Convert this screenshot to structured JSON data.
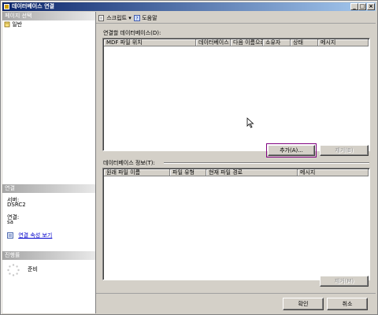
{
  "window": {
    "title": "데이터베이스 연결"
  },
  "sidebar": {
    "page_select_header": "페이지 선택",
    "pages": [
      {
        "label": "일반"
      }
    ],
    "connection_header": "연결",
    "server_label": "서버:",
    "server_value": "DSRC2",
    "connection_label": "연결:",
    "connection_value": "sa",
    "view_properties_link": "연결 속성 보기",
    "progress_header": "진행률",
    "progress_status": "준비"
  },
  "toolbar": {
    "script_label": "스크립트",
    "help_label": "도움말"
  },
  "attach_section": {
    "label": "연결할 데이터베이스(D):",
    "columns": [
      "MDF 파일 위치",
      "데이터베이스",
      "다음 이름으로...",
      "소유자",
      "상태",
      "메시지"
    ],
    "rows": [],
    "add_button": "추가(A)...",
    "remove_button": "제거(B)"
  },
  "details_section": {
    "label": "데이터베이스 정보(T):",
    "columns": [
      "원래 파일 이름",
      "파일 유형",
      "현재 파일 경로",
      "메시지"
    ],
    "rows": [],
    "remove_button": "제거(M)"
  },
  "footer": {
    "ok_button": "확인",
    "cancel_button": "취소"
  }
}
